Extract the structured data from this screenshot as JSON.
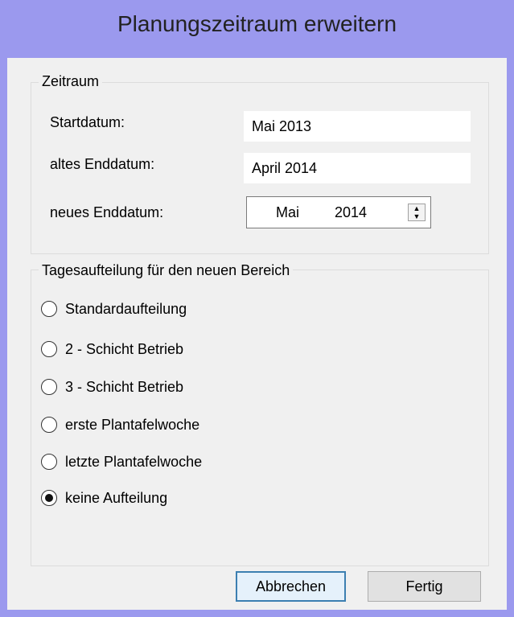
{
  "window": {
    "title": "Planungszeitraum erweitern"
  },
  "zeitraum": {
    "legend": "Zeitraum",
    "start_label": "Startdatum:",
    "start_value": "Mai 2013",
    "old_end_label": "altes Enddatum:",
    "old_end_value": "April 2014",
    "new_end_label": "neues Enddatum:",
    "new_end_month": "Mai",
    "new_end_year": "2014"
  },
  "aufteilung": {
    "legend": "Tagesaufteilung für den neuen Bereich",
    "options": [
      {
        "label": "Standardaufteilung",
        "checked": false
      },
      {
        "label": "2 - Schicht Betrieb",
        "checked": false
      },
      {
        "label": "3 - Schicht Betrieb",
        "checked": false
      },
      {
        "label": "erste Plantafelwoche",
        "checked": false
      },
      {
        "label": "letzte Plantafelwoche",
        "checked": false
      },
      {
        "label": "keine Aufteilung",
        "checked": true
      }
    ]
  },
  "buttons": {
    "cancel": "Abbrechen",
    "finish": "Fertig"
  },
  "colors": {
    "titlebar": "#9b99ee",
    "client": "#f0f0f0",
    "default_button_border": "#3c7fb1"
  }
}
